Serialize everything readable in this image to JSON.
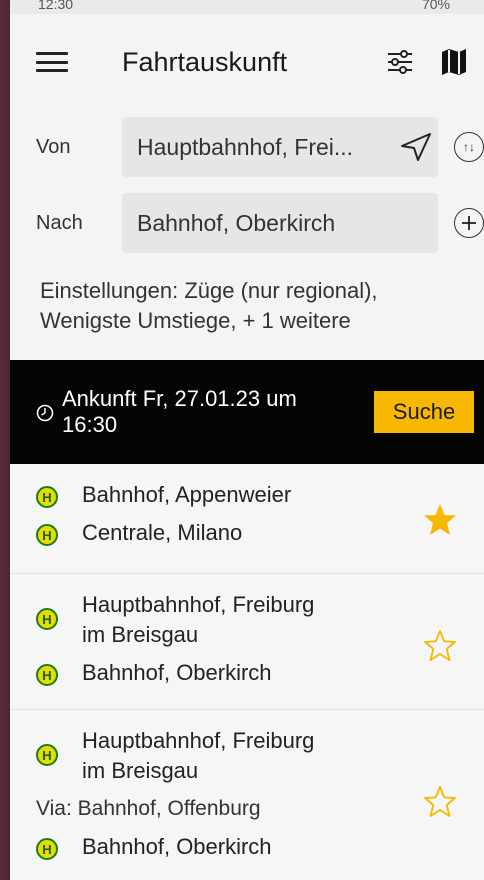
{
  "status_bar": {
    "time": "12:30",
    "right": "70%"
  },
  "header": {
    "title": "Fahrtauskunft"
  },
  "form": {
    "from_label": "Von",
    "from_value": "Hauptbahnhof, Frei...",
    "to_label": "Nach",
    "to_value": "Bahnhof, Oberkirch",
    "swap_label": "↑↓"
  },
  "settings_text": {
    "line1": "Einstellungen: Züge (nur regional),",
    "line2": "Wenigste Umstiege, + 1 weitere"
  },
  "arrival": {
    "line1": "Ankunft Fr, 27.01.23 um",
    "line2": "16:30",
    "search_label": "Suche"
  },
  "connections": [
    {
      "from": "Bahnhof, Appenweier",
      "to": "Centrale, Milano",
      "favorite": true
    },
    {
      "from_line1": "Hauptbahnhof, Freiburg",
      "from_line2": "im Breisgau",
      "to": "Bahnhof, Oberkirch",
      "favorite": false
    },
    {
      "from_line1": "Hauptbahnhof, Freiburg",
      "from_line2": "im Breisgau",
      "via": "Via: Bahnhof, Offenburg",
      "to": "Bahnhof, Oberkirch",
      "favorite": false
    }
  ],
  "badge_letter": "H",
  "colors": {
    "accent": "#f6b800",
    "star": "#f6b800",
    "badge": "#e3de00",
    "badge_border": "#1f7a1f",
    "dark": "#050505"
  }
}
